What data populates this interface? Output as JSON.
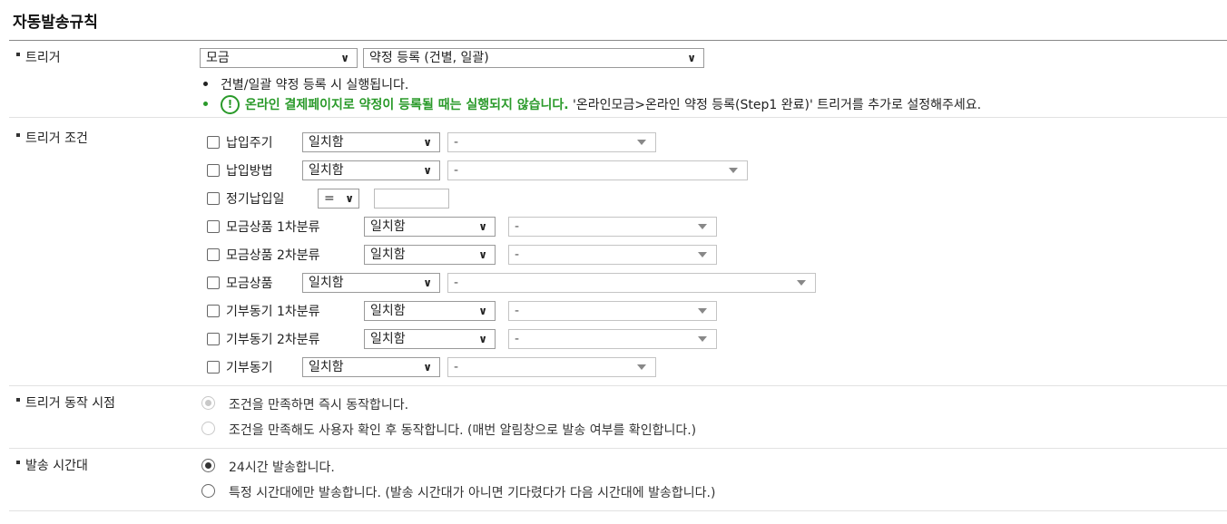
{
  "page_title": "자동발송규칙",
  "trigger": {
    "label": "트리거",
    "select1": "모금",
    "select2": "약정 등록 (건별, 일괄)",
    "note1": "건별/일괄 약정 등록 시 실행됩니다.",
    "note2_icon": "!",
    "note2_bold": "온라인 결제페이지로 약정이 등록될 때는 실행되지 않습니다.",
    "note2_rest": "'온라인모금>온라인 약정 등록(Step1 완료)' 트리거를 추가로 설정해주세요."
  },
  "conditions": {
    "label": "트리거 조건",
    "match_text": "일치함",
    "value_placeholder": "-",
    "eq_text": "=",
    "items": [
      {
        "name": "납입주기"
      },
      {
        "name": "납입방법"
      },
      {
        "name": "정기납입일"
      },
      {
        "name": "모금상품 1차분류"
      },
      {
        "name": "모금상품 2차분류"
      },
      {
        "name": "모금상품"
      },
      {
        "name": "기부동기 1차분류"
      },
      {
        "name": "기부동기 2차분류"
      },
      {
        "name": "기부동기"
      }
    ]
  },
  "timing": {
    "label": "트리거 동작 시점",
    "opt1": "조건을 만족하면 즉시 동작합니다.",
    "opt2": "조건을 만족해도 사용자 확인 후 동작합니다. (매번 알림창으로 발송 여부를 확인합니다.)"
  },
  "sendtime": {
    "label": "발송 시간대",
    "opt1": "24시간 발송합니다.",
    "opt2": "특정 시간대에만 발송합니다. (발송 시간대가 아니면 기다렸다가 다음 시간대에 발송합니다.)"
  },
  "colors": {
    "accent_green": "#2a9a2a"
  }
}
